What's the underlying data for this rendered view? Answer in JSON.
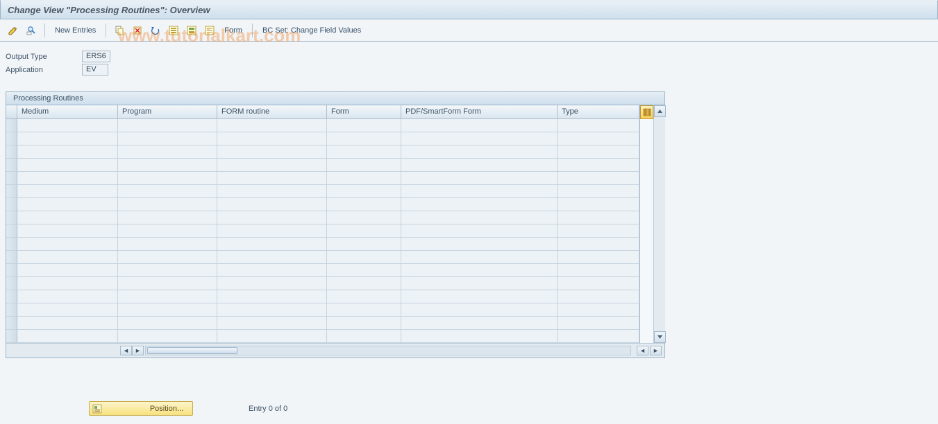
{
  "title": "Change View \"Processing Routines\": Overview",
  "watermark": "www.tutorialkart.com",
  "toolbar": {
    "new_entries_label": "New Entries",
    "form_label": "Form",
    "bcset_label": "BC Set: Change Field Values"
  },
  "header": {
    "output_type_label": "Output Type",
    "output_type_value": "ERS6",
    "application_label": "Application",
    "application_value": "EV"
  },
  "table": {
    "title": "Processing Routines",
    "columns": [
      "Medium",
      "Program",
      "FORM routine",
      "Form",
      "PDF/SmartForm Form",
      "Type"
    ],
    "row_count": 17
  },
  "footer": {
    "position_label": "Position...",
    "entry_text": "Entry 0 of 0"
  }
}
